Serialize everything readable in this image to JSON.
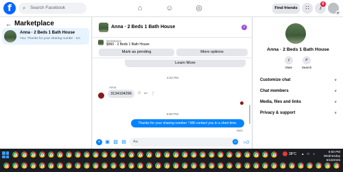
{
  "topbar": {
    "logo_letter": "f",
    "search_placeholder": "Search Facebook",
    "find_friends": "Find friends",
    "notification_count": "6"
  },
  "left_panel": {
    "title": "Marketplace",
    "conversation": {
      "title": "Anna · 2 Beds 1 Bath House",
      "preview": "You: Thanks for your sharing numbe · 1m"
    }
  },
  "chat": {
    "header_title": "Anna · 2 Beds 1 Bath House",
    "listing_source": "Marketplace",
    "listing_price_title": "$960 · 2 Beds 1 Bath House",
    "mark_pending": "Mark as pending",
    "more_options": "More options",
    "learn_more": "Learn More",
    "timestamp_1": "3:32 PM",
    "sender_name": "Anna",
    "incoming_message": "3134104296",
    "timestamp_2": "8:50 PM",
    "outgoing_message": "Thanks for your sharing number ! Will contact you in a short time.",
    "sent_status": "Sent",
    "composer_placeholder": "Aa"
  },
  "right_panel": {
    "title": "Anna · 2 Beds 1 Bath House",
    "actions": [
      {
        "label": "Mute",
        "icon": "bell-icon"
      },
      {
        "label": "Search",
        "icon": "search-icon"
      }
    ],
    "sections": [
      {
        "label": "Customize chat"
      },
      {
        "label": "Chat members"
      },
      {
        "label": "Media, files and links"
      },
      {
        "label": "Privacy & support"
      }
    ]
  },
  "taskbar": {
    "temperature": "38°C",
    "time": "8:50 PM",
    "day": "Wednesday",
    "date": "6/18/2025"
  },
  "colors": {
    "brand": "#0866ff",
    "messenger_blue": "#0084ff",
    "selected_bg": "#e7f3ff",
    "badge_red": "#e41e3f"
  }
}
